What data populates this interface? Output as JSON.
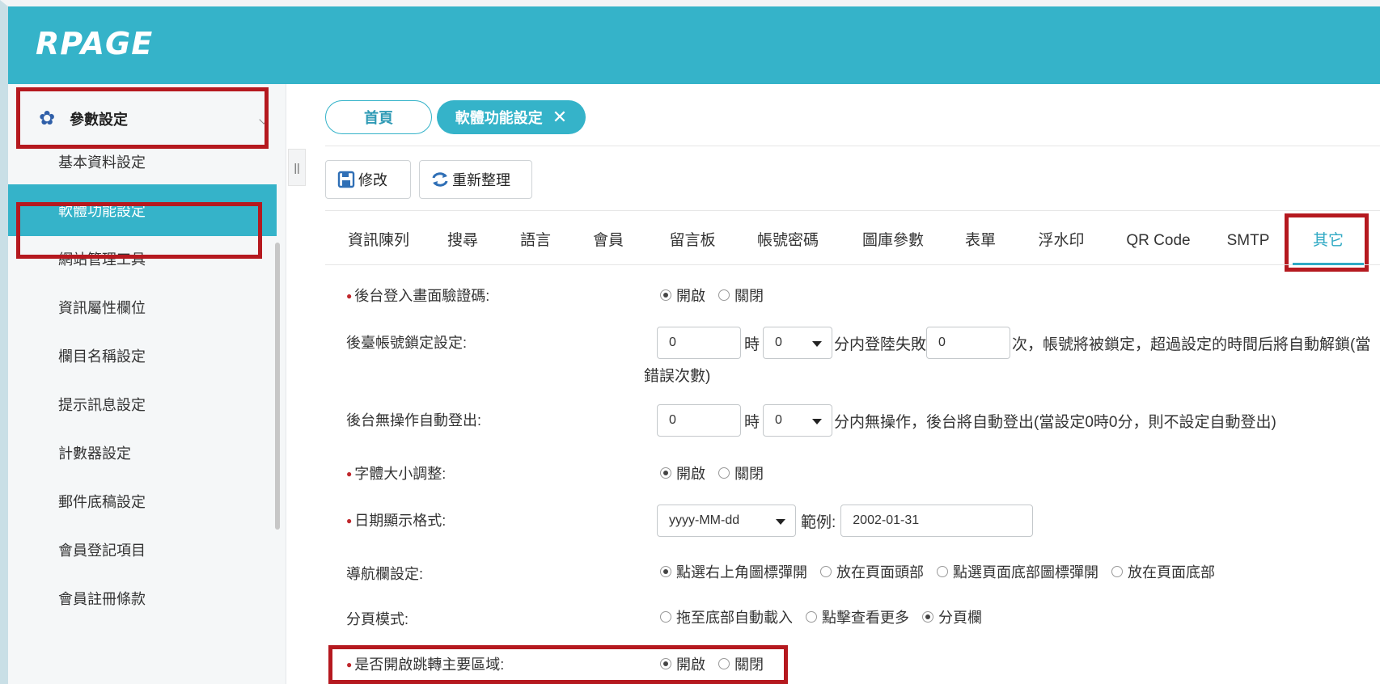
{
  "app": {
    "logo": "RPAGE"
  },
  "sidebar": {
    "section_label": "參數設定",
    "items": [
      {
        "label": "基本資料設定",
        "active": false
      },
      {
        "label": "軟體功能設定",
        "active": true
      },
      {
        "label": "網站管理工具",
        "active": false
      },
      {
        "label": "資訊屬性欄位",
        "active": false
      },
      {
        "label": "欄目名稱設定",
        "active": false
      },
      {
        "label": "提示訊息設定",
        "active": false
      },
      {
        "label": "計數器設定",
        "active": false
      },
      {
        "label": "郵件底稿設定",
        "active": false
      },
      {
        "label": "會員登記項目",
        "active": false
      },
      {
        "label": "會員註冊條款",
        "active": false
      }
    ]
  },
  "tabs": {
    "home": "首頁",
    "current": "軟體功能設定",
    "close": "✕"
  },
  "toolbar": {
    "save": "修改",
    "refresh": "重新整理"
  },
  "feature_tabs": [
    "資訊陳列",
    "搜尋",
    "語言",
    "會員",
    "留言板",
    "帳號密碼",
    "圖庫參數",
    "表單",
    "浮水印",
    "QR Code",
    "SMTP",
    "其它"
  ],
  "active_feature_tab": "其它",
  "form": {
    "captcha": {
      "label": "後台登入畫面驗證碼:",
      "on": "開啟",
      "off": "關閉",
      "value": "開啟"
    },
    "lock": {
      "label": "後臺帳號鎖定設定:",
      "hours": "0",
      "hours_unit": "時",
      "minutes": "0",
      "minutes_text": "分内登陸失敗",
      "count": "0",
      "desc": "次，帳號將被鎖定，超過設定的時間后將自動解鎖(當",
      "desc2": "錯誤次數)"
    },
    "idle": {
      "label": "後台無操作自動登出:",
      "hours": "0",
      "hours_unit": "時",
      "minutes": "0",
      "desc": "分内無操作，後台將自動登出(當設定0時0分，則不設定自動登出)"
    },
    "font_size": {
      "label": "字體大小調整:",
      "on": "開啟",
      "off": "關閉",
      "value": "開啟"
    },
    "date_format": {
      "label": "日期顯示格式:",
      "value": "yyyy-MM-dd",
      "example_label": "範例:",
      "example": "2002-01-31"
    },
    "nav": {
      "label": "導航欄設定:",
      "options": [
        "點選右上角圖標彈開",
        "放在頁面頭部",
        "點選頁面底部圖標彈開",
        "放在頁面底部"
      ],
      "value": "點選右上角圖標彈開"
    },
    "paging": {
      "label": "分頁模式:",
      "options": [
        "拖至底部自動載入",
        "點擊查看更多",
        "分頁欄"
      ],
      "value": "分頁欄"
    },
    "jump": {
      "label": "是否開啟跳轉主要區域:",
      "on": "開啟",
      "off": "關閉",
      "value": "開啟"
    }
  },
  "colors": {
    "accent": "#35b3c9",
    "highlight_box": "#b5191f",
    "required_star": "#c0282d"
  }
}
